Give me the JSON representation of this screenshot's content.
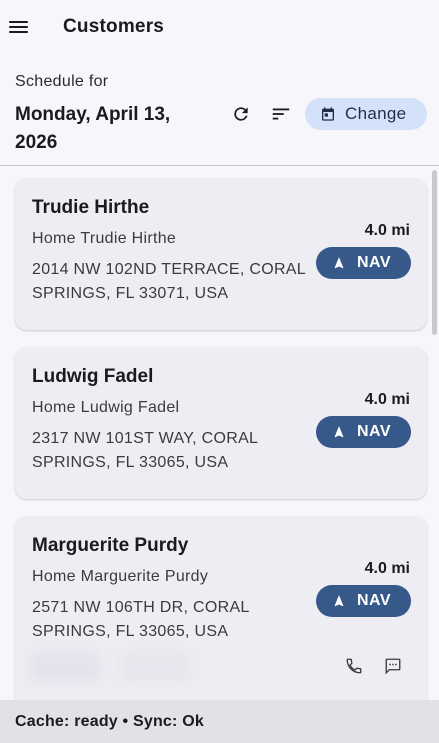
{
  "header": {
    "title": "Customers",
    "menu_icon": "hamburger-menu-icon"
  },
  "schedule": {
    "label": "Schedule for",
    "date": "Monday, April 13, 2026",
    "refresh_icon": "refresh-icon",
    "sort_icon": "sort-icon",
    "change_label": "Change",
    "change_icon": "calendar-icon"
  },
  "customers": [
    {
      "name": "Trudie Hirthe",
      "location": "Home Trudie Hirthe",
      "address": "2014 NW 102ND TERRACE, CORAL SPRINGS, FL 33071, USA",
      "distance": "4.0 mi",
      "nav_label": "NAV"
    },
    {
      "name": "Ludwig Fadel",
      "location": "Home Ludwig Fadel",
      "address": "2317 NW 101ST WAY, CORAL SPRINGS, FL 33065, USA",
      "distance": "4.0 mi",
      "nav_label": "NAV"
    },
    {
      "name": "Marguerite Purdy",
      "location": "Home Marguerite Purdy",
      "address": "2571 NW 106TH DR, CORAL SPRINGS, FL 33065, USA",
      "distance": "4.0 mi",
      "nav_label": "NAV",
      "actions": [
        "phone-icon",
        "message-icon"
      ]
    }
  ],
  "status": {
    "text": "Cache: ready • Sync: Ok"
  },
  "colors": {
    "accent": "#37598a",
    "chip": "#d3e2f8",
    "card": "#ededf3",
    "background": "#f7f7fb",
    "statusbar": "#e1e2e8"
  }
}
